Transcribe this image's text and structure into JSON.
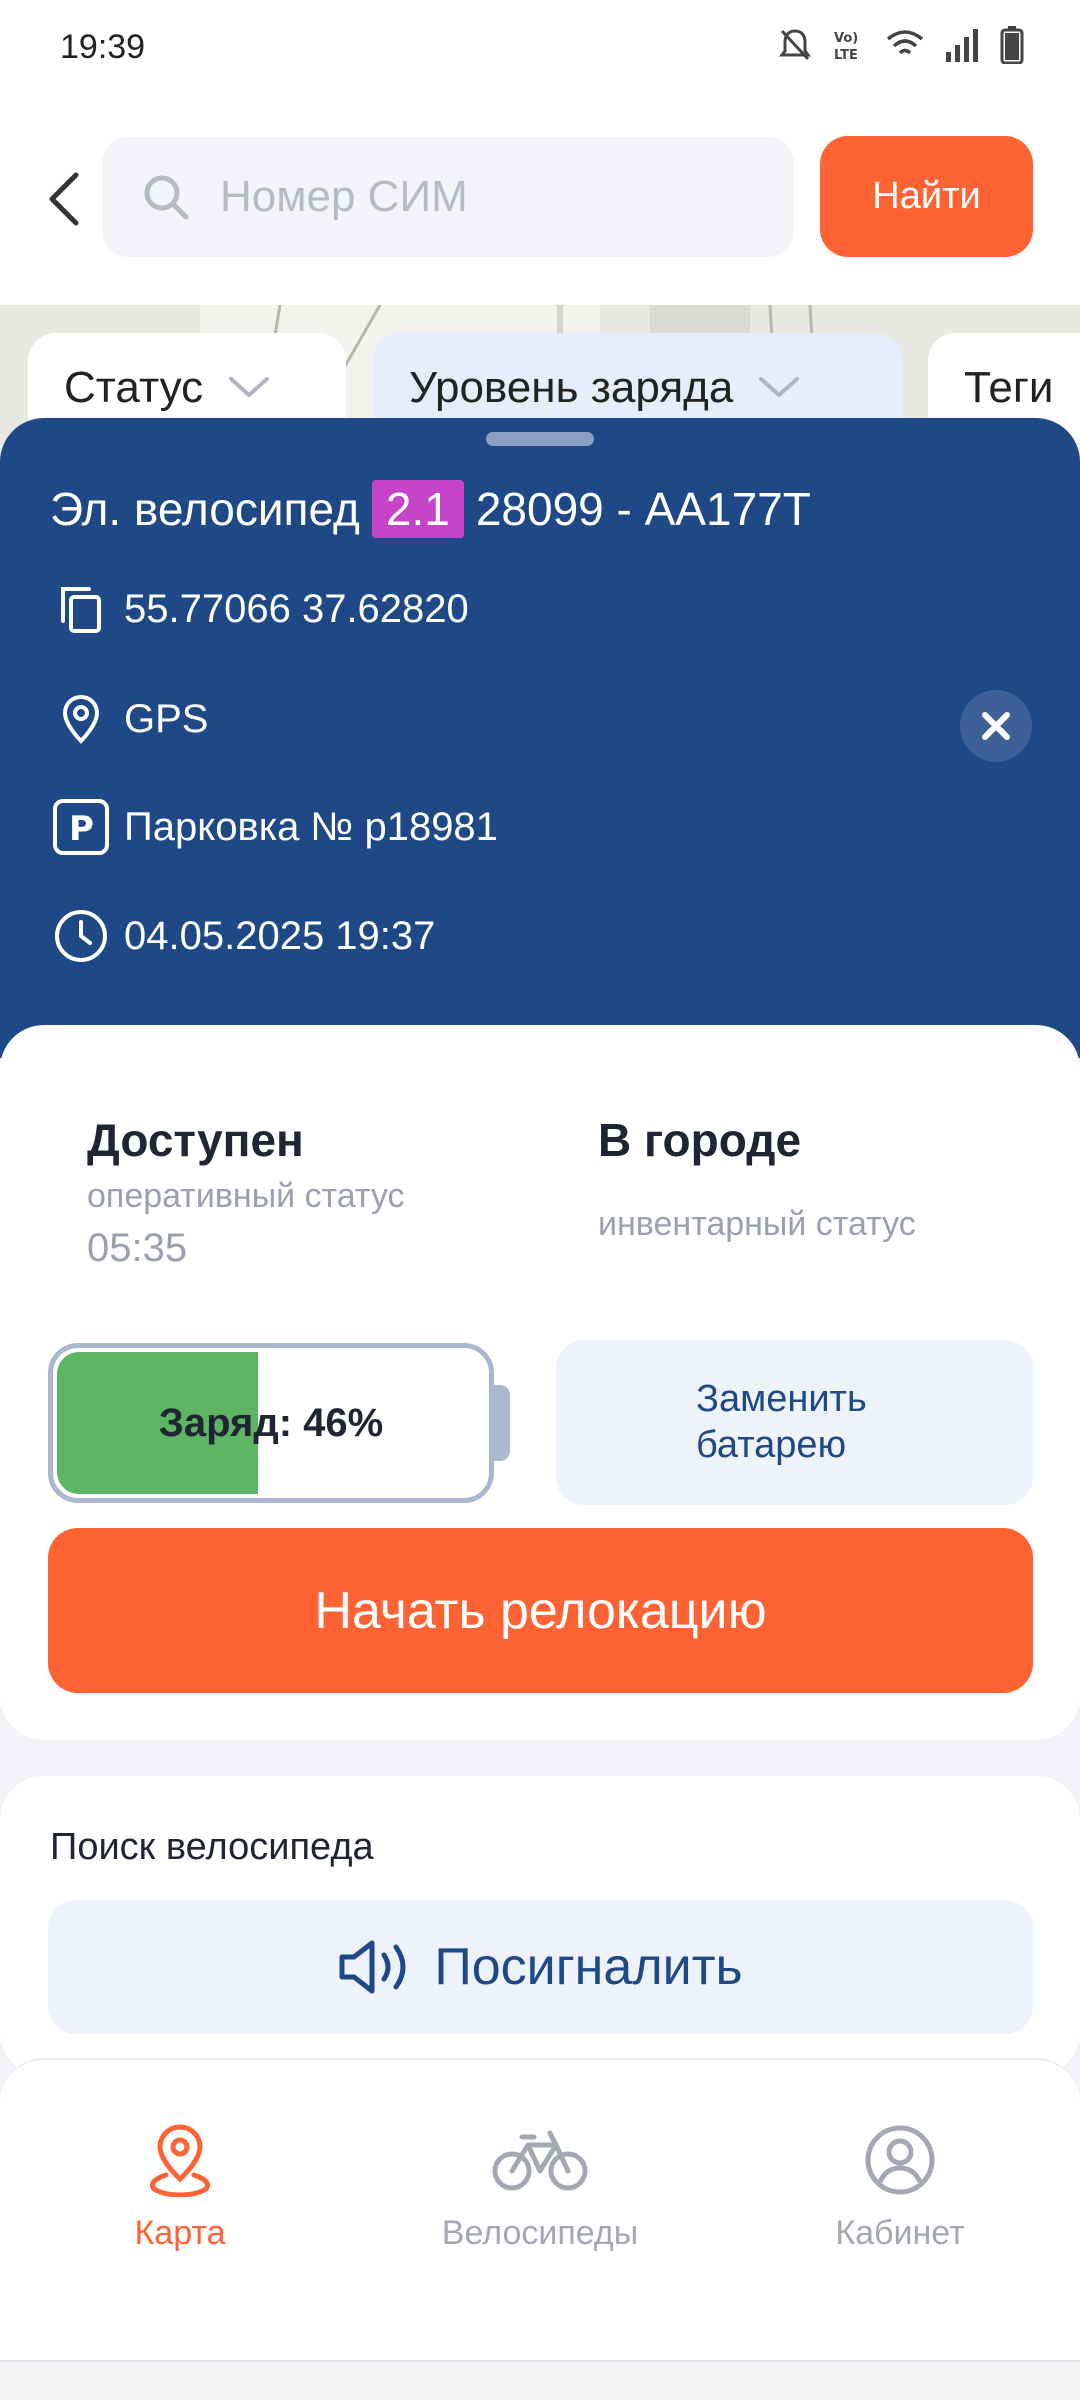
{
  "status_bar": {
    "time": "19:39",
    "icons": [
      "mute-icon",
      "volte-icon",
      "wifi-icon",
      "signal-icon",
      "battery-icon"
    ]
  },
  "search": {
    "placeholder": "Номер СИМ",
    "value": "",
    "find_label": "Найти"
  },
  "filters": {
    "status": "Статус",
    "charge_level": "Уровень заряда",
    "tags": "Теги"
  },
  "vehicle": {
    "type_label": "Эл. велосипед",
    "model_badge": "2.1",
    "id_plate": "28099 - АА177Т",
    "coordinates": "55.77066 37.62820",
    "location_source": "GPS",
    "parking": "Парковка № р18981",
    "timestamp": "04.05.2025 19:37"
  },
  "status": {
    "operational_value": "Доступен",
    "operational_caption": "оперативный статус",
    "operational_time": "05:35",
    "inventory_value": "В городе",
    "inventory_caption": "инвентарный статус"
  },
  "battery": {
    "label": "Заряд: 46%",
    "level_percent": 46,
    "fill_color": "#5bb563"
  },
  "actions": {
    "replace_battery": "Заменить батарею",
    "start_relocation": "Начать релокацию"
  },
  "bike_search": {
    "title": "Поиск велосипеда",
    "beep_label": "Посигналить"
  },
  "nav": {
    "map": "Карта",
    "bikes": "Велосипеды",
    "cabinet": "Кабинет",
    "active": "map"
  },
  "colors": {
    "accent": "#ff6233",
    "card_blue": "#1f4887",
    "badge_magenta": "#c544c7"
  }
}
